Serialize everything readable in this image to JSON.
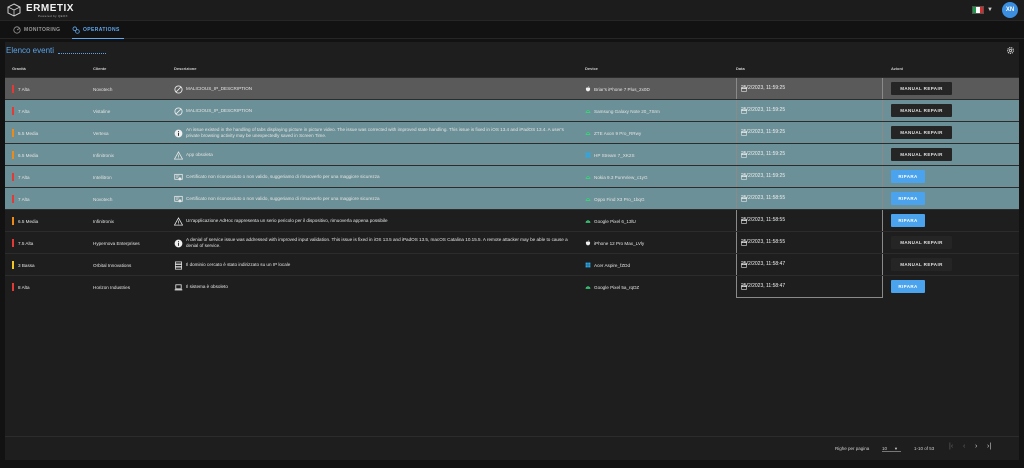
{
  "app": {
    "brand": "ERMETIX",
    "brand_sub": "Powered by QEOX",
    "language": "IT",
    "avatar_initials": "XN"
  },
  "tabs": [
    {
      "label": "MONITORING",
      "active": false,
      "icon": "monitoring-icon"
    },
    {
      "label": "OPERATIONS",
      "active": true,
      "icon": "operations-icon"
    }
  ],
  "page": {
    "title": "Elenco eventi"
  },
  "table": {
    "headers": [
      "Gravità",
      "Cliente",
      "Descrizione",
      "Device",
      "Data",
      "Azioni"
    ],
    "rows": [
      {
        "severity": "7 Alta",
        "sev_color": "#e53935",
        "client": "Novotech",
        "desc": "MALICIOUS_IP_DESCRIPTION",
        "desc_icon": "block-icon",
        "device": "Briar's iPhone 7 Plus_2x0D",
        "device_icon": "apple-icon",
        "date": "25/2/2023, 11:59:25",
        "action": "MANUAL REPAIR",
        "action_type": "manual",
        "highlight": "gray"
      },
      {
        "severity": "7 Alta",
        "sev_color": "#e53935",
        "client": "Vistaline",
        "desc": "MALICIOUS_IP_DESCRIPTION",
        "desc_icon": "block-icon",
        "device": "Samsung Galaxy Note 20_7Srm",
        "device_icon": "android-icon",
        "date": "25/2/2023, 11:59:25",
        "action": "MANUAL REPAIR",
        "action_type": "manual",
        "highlight": "teal"
      },
      {
        "severity": "5.5 Media",
        "sev_color": "#ef8a17",
        "client": "Vertexa",
        "desc": "An issue existed in the handling of tabs displaying picture in picture video. The issue was corrected with improved state handling. This issue is fixed in iOS 13.4 and iPadOS 13.4. A user's private browsing activity may be unexpectedly saved in Screen Time.",
        "desc_icon": "info-icon",
        "device": "ZTE Axon 9 Pro_RRwy",
        "device_icon": "android-icon",
        "date": "25/2/2023, 11:59:25",
        "action": "MANUAL REPAIR",
        "action_type": "manual",
        "highlight": "teal"
      },
      {
        "severity": "6.5 Media",
        "sev_color": "#ef8a17",
        "client": "Infinitronix",
        "desc": "App obsoleta",
        "desc_icon": "warning-icon",
        "device": "HP Stream 7_XK2S",
        "device_icon": "windows-icon",
        "date": "25/2/2023, 11:59:25",
        "action": "MANUAL REPAIR",
        "action_type": "manual",
        "highlight": "teal"
      },
      {
        "severity": "7 Alta",
        "sev_color": "#e53935",
        "client": "Intellitron",
        "desc": "Certificato non riconosciuto o non valido, suggeriamo di rimuoverlo per una maggiore sicurezza",
        "desc_icon": "certificate-icon",
        "device": "Nokia 9.3 PureView_c1yG",
        "device_icon": "android-icon",
        "date": "25/2/2023, 11:59:25",
        "action": "RIPARA",
        "action_type": "ripara",
        "highlight": "teal"
      },
      {
        "severity": "7 Alta",
        "sev_color": "#e53935",
        "client": "Novotech",
        "desc": "Certificato non riconosciuto o non valido, suggeriamo di rimuoverlo per una maggiore sicurezza",
        "desc_icon": "certificate-icon",
        "device": "Oppo Find X3 Pro_1bqG",
        "device_icon": "android-icon",
        "date": "25/2/2023, 11:58:55",
        "action": "RIPARA",
        "action_type": "ripara",
        "highlight": "teal"
      },
      {
        "severity": "6.5 Media",
        "sev_color": "#ef8a17",
        "client": "Infinitronix",
        "desc": "Un'applicazione AdHoc rappresenta un serio pericolo per il dispositivo, rimuoverla appena possibile",
        "desc_icon": "warning-icon",
        "device": "Google Pixel 6_13lU",
        "device_icon": "android-icon",
        "date": "25/2/2023, 11:58:55",
        "action": "RIPARA",
        "action_type": "ripara",
        "highlight": "none"
      },
      {
        "severity": "7.5 Alta",
        "sev_color": "#e53935",
        "client": "Hypernova Enterprises",
        "desc": "A denial of service issue was addressed with improved input validation. This issue is fixed in iOS 13.5 and iPadOS 13.5, macOS Catalina 10.15.5. A remote attacker may be able to cause a denial of service.",
        "desc_icon": "info-icon",
        "device": "iPhone 12 Pro Max_LVly",
        "device_icon": "apple-icon",
        "date": "25/2/2023, 11:58:55",
        "action": "MANUAL REPAIR",
        "action_type": "manual",
        "highlight": "none"
      },
      {
        "severity": "3 Bassa",
        "sev_color": "#f2c521",
        "client": "Orbital Innovations",
        "desc": "Il dominio cercato è stato indirizzato su un IP locale",
        "desc_icon": "server-icon",
        "device": "Acer Aspire_fZDd",
        "device_icon": "windows-icon",
        "date": "25/2/2023, 11:58:47",
        "action": "MANUAL REPAIR",
        "action_type": "manual",
        "highlight": "none"
      },
      {
        "severity": "8 Alta",
        "sev_color": "#e53935",
        "client": "Horizon Industries",
        "desc": "Il sistema è obsoleto",
        "desc_icon": "laptop-icon",
        "device": "Google Pixel 5a_rqDZ",
        "device_icon": "android-icon",
        "date": "25/2/2023, 11:58:47",
        "action": "RIPARA",
        "action_type": "ripara",
        "highlight": "none"
      }
    ]
  },
  "footer": {
    "rows_per_page_label": "Righe per pagina",
    "rows_per_page": "10",
    "range": "1-10 of 53"
  },
  "colors": {
    "accent": "#4aa3ec",
    "highlight_gray": "#5a5a5a",
    "highlight_teal": "#6c9097",
    "severity_high": "#e53935",
    "severity_medium": "#ef8a17",
    "severity_low": "#f2c521"
  }
}
